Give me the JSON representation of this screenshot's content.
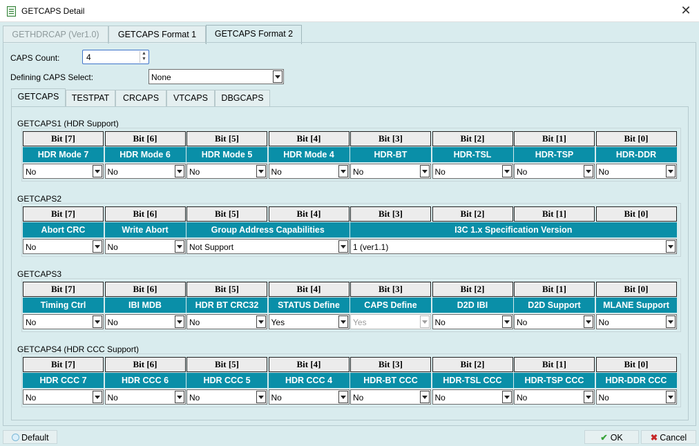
{
  "window": {
    "title": "GETCAPS Detail"
  },
  "tabs": [
    "GETHDRCAP (Ver1.0)",
    "GETCAPS Format 1",
    "GETCAPS Format 2"
  ],
  "form": {
    "caps_count_label": "CAPS Count:",
    "caps_count_value": "4",
    "defining_label": "Defining CAPS Select:",
    "defining_value": "None"
  },
  "subtabs": [
    "GETCAPS",
    "TESTPAT",
    "CRCAPS",
    "VTCAPS",
    "DBGCAPS"
  ],
  "bits": [
    "Bit [7]",
    "Bit [6]",
    "Bit [5]",
    "Bit [4]",
    "Bit [3]",
    "Bit [2]",
    "Bit [1]",
    "Bit [0]"
  ],
  "groups": [
    {
      "label": "GETCAPS1 (HDR Support)",
      "fields": [
        {
          "name": "HDR Mode 7",
          "span": 1,
          "value": "No"
        },
        {
          "name": "HDR Mode 6",
          "span": 1,
          "value": "No"
        },
        {
          "name": "HDR Mode 5",
          "span": 1,
          "value": "No"
        },
        {
          "name": "HDR Mode 4",
          "span": 1,
          "value": "No"
        },
        {
          "name": "HDR-BT",
          "span": 1,
          "value": "No"
        },
        {
          "name": "HDR-TSL",
          "span": 1,
          "value": "No"
        },
        {
          "name": "HDR-TSP",
          "span": 1,
          "value": "No"
        },
        {
          "name": "HDR-DDR",
          "span": 1,
          "value": "No"
        }
      ]
    },
    {
      "label": "GETCAPS2",
      "fields": [
        {
          "name": "Abort CRC",
          "span": 1,
          "value": "No"
        },
        {
          "name": "Write Abort",
          "span": 1,
          "value": "No"
        },
        {
          "name": "Group Address Capabilities",
          "span": 2,
          "value": "Not Support"
        },
        {
          "name": "I3C 1.x Specification Version",
          "span": 4,
          "value": "1 (ver1.1)"
        }
      ]
    },
    {
      "label": "GETCAPS3",
      "fields": [
        {
          "name": "Timing Ctrl",
          "span": 1,
          "value": "No"
        },
        {
          "name": "IBI MDB",
          "span": 1,
          "value": "No"
        },
        {
          "name": "HDR BT CRC32",
          "span": 1,
          "value": "No"
        },
        {
          "name": "STATUS Define",
          "span": 1,
          "value": "Yes"
        },
        {
          "name": "CAPS Define",
          "span": 1,
          "value": "Yes",
          "disabled": true
        },
        {
          "name": "D2D IBI",
          "span": 1,
          "value": "No"
        },
        {
          "name": "D2D Support",
          "span": 1,
          "value": "No"
        },
        {
          "name": "MLANE Support",
          "span": 1,
          "value": "No"
        }
      ]
    },
    {
      "label": "GETCAPS4 (HDR CCC Support)",
      "fields": [
        {
          "name": "HDR CCC 7",
          "span": 1,
          "value": "No"
        },
        {
          "name": "HDR CCC 6",
          "span": 1,
          "value": "No"
        },
        {
          "name": "HDR CCC 5",
          "span": 1,
          "value": "No"
        },
        {
          "name": "HDR CCC 4",
          "span": 1,
          "value": "No"
        },
        {
          "name": "HDR-BT CCC",
          "span": 1,
          "value": "No"
        },
        {
          "name": "HDR-TSL CCC",
          "span": 1,
          "value": "No"
        },
        {
          "name": "HDR-TSP CCC",
          "span": 1,
          "value": "No"
        },
        {
          "name": "HDR-DDR CCC",
          "span": 1,
          "value": "No"
        }
      ]
    }
  ],
  "buttons": {
    "default": "Default",
    "ok": "OK",
    "cancel": "Cancel"
  },
  "colors": {
    "header": "#0a8fa8",
    "background": "#d9ecee"
  }
}
